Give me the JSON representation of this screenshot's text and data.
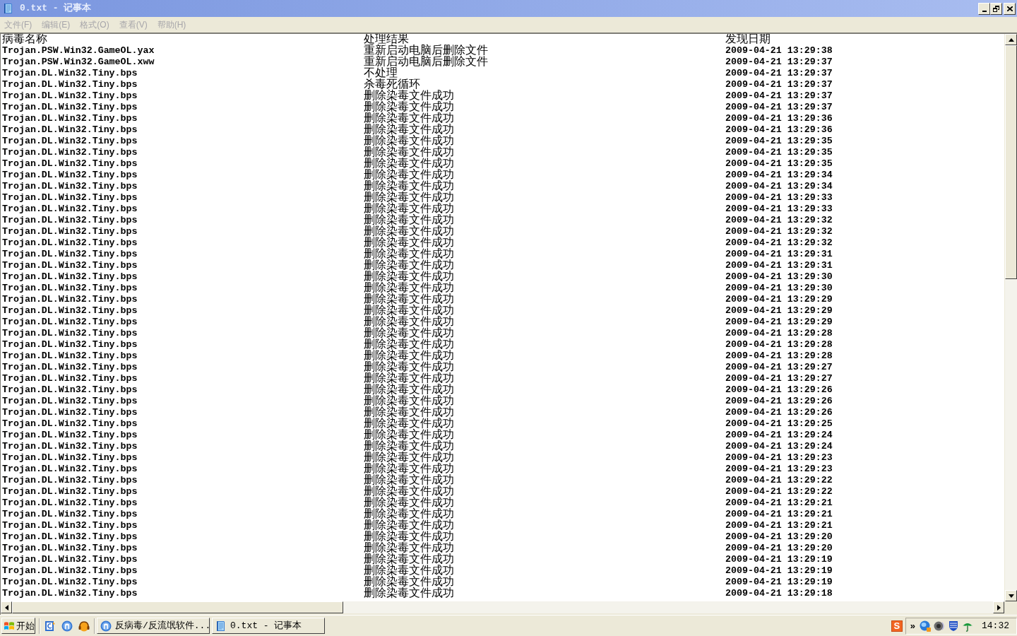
{
  "window": {
    "title": "0.txt - 记事本",
    "active": false
  },
  "menu": [
    "文件(F)",
    "编辑(E)",
    "格式(O)",
    "查看(V)",
    "帮助(H)"
  ],
  "document": {
    "header": [
      "病毒名称",
      "处理结果",
      "发现日期"
    ],
    "rows": [
      {
        "name": "Trojan.PSW.Win32.GameOL.yax",
        "result": "重新启动电脑后删除文件",
        "date": "2009-04-21 13:29:38"
      },
      {
        "name": "Trojan.PSW.Win32.GameOL.xww",
        "result": "重新启动电脑后删除文件",
        "date": "2009-04-21 13:29:37"
      },
      {
        "name": "Trojan.DL.Win32.Tiny.bps",
        "result": "不处理",
        "date": "2009-04-21 13:29:37"
      },
      {
        "name": "Trojan.DL.Win32.Tiny.bps",
        "result": "杀毒死循环",
        "date": "2009-04-21 13:29:37"
      },
      {
        "name": "Trojan.DL.Win32.Tiny.bps",
        "result": "删除染毒文件成功",
        "date": "2009-04-21 13:29:37"
      },
      {
        "name": "Trojan.DL.Win32.Tiny.bps",
        "result": "删除染毒文件成功",
        "date": "2009-04-21 13:29:37"
      },
      {
        "name": "Trojan.DL.Win32.Tiny.bps",
        "result": "删除染毒文件成功",
        "date": "2009-04-21 13:29:36"
      },
      {
        "name": "Trojan.DL.Win32.Tiny.bps",
        "result": "删除染毒文件成功",
        "date": "2009-04-21 13:29:36"
      },
      {
        "name": "Trojan.DL.Win32.Tiny.bps",
        "result": "删除染毒文件成功",
        "date": "2009-04-21 13:29:35"
      },
      {
        "name": "Trojan.DL.Win32.Tiny.bps",
        "result": "删除染毒文件成功",
        "date": "2009-04-21 13:29:35"
      },
      {
        "name": "Trojan.DL.Win32.Tiny.bps",
        "result": "删除染毒文件成功",
        "date": "2009-04-21 13:29:35"
      },
      {
        "name": "Trojan.DL.Win32.Tiny.bps",
        "result": "删除染毒文件成功",
        "date": "2009-04-21 13:29:34"
      },
      {
        "name": "Trojan.DL.Win32.Tiny.bps",
        "result": "删除染毒文件成功",
        "date": "2009-04-21 13:29:34"
      },
      {
        "name": "Trojan.DL.Win32.Tiny.bps",
        "result": "删除染毒文件成功",
        "date": "2009-04-21 13:29:33"
      },
      {
        "name": "Trojan.DL.Win32.Tiny.bps",
        "result": "删除染毒文件成功",
        "date": "2009-04-21 13:29:33"
      },
      {
        "name": "Trojan.DL.Win32.Tiny.bps",
        "result": "删除染毒文件成功",
        "date": "2009-04-21 13:29:32"
      },
      {
        "name": "Trojan.DL.Win32.Tiny.bps",
        "result": "删除染毒文件成功",
        "date": "2009-04-21 13:29:32"
      },
      {
        "name": "Trojan.DL.Win32.Tiny.bps",
        "result": "删除染毒文件成功",
        "date": "2009-04-21 13:29:32"
      },
      {
        "name": "Trojan.DL.Win32.Tiny.bps",
        "result": "删除染毒文件成功",
        "date": "2009-04-21 13:29:31"
      },
      {
        "name": "Trojan.DL.Win32.Tiny.bps",
        "result": "删除染毒文件成功",
        "date": "2009-04-21 13:29:31"
      },
      {
        "name": "Trojan.DL.Win32.Tiny.bps",
        "result": "删除染毒文件成功",
        "date": "2009-04-21 13:29:30"
      },
      {
        "name": "Trojan.DL.Win32.Tiny.bps",
        "result": "删除染毒文件成功",
        "date": "2009-04-21 13:29:30"
      },
      {
        "name": "Trojan.DL.Win32.Tiny.bps",
        "result": "删除染毒文件成功",
        "date": "2009-04-21 13:29:29"
      },
      {
        "name": "Trojan.DL.Win32.Tiny.bps",
        "result": "删除染毒文件成功",
        "date": "2009-04-21 13:29:29"
      },
      {
        "name": "Trojan.DL.Win32.Tiny.bps",
        "result": "删除染毒文件成功",
        "date": "2009-04-21 13:29:29"
      },
      {
        "name": "Trojan.DL.Win32.Tiny.bps",
        "result": "删除染毒文件成功",
        "date": "2009-04-21 13:29:28"
      },
      {
        "name": "Trojan.DL.Win32.Tiny.bps",
        "result": "删除染毒文件成功",
        "date": "2009-04-21 13:29:28"
      },
      {
        "name": "Trojan.DL.Win32.Tiny.bps",
        "result": "删除染毒文件成功",
        "date": "2009-04-21 13:29:28"
      },
      {
        "name": "Trojan.DL.Win32.Tiny.bps",
        "result": "删除染毒文件成功",
        "date": "2009-04-21 13:29:27"
      },
      {
        "name": "Trojan.DL.Win32.Tiny.bps",
        "result": "删除染毒文件成功",
        "date": "2009-04-21 13:29:27"
      },
      {
        "name": "Trojan.DL.Win32.Tiny.bps",
        "result": "删除染毒文件成功",
        "date": "2009-04-21 13:29:26"
      },
      {
        "name": "Trojan.DL.Win32.Tiny.bps",
        "result": "删除染毒文件成功",
        "date": "2009-04-21 13:29:26"
      },
      {
        "name": "Trojan.DL.Win32.Tiny.bps",
        "result": "删除染毒文件成功",
        "date": "2009-04-21 13:29:26"
      },
      {
        "name": "Trojan.DL.Win32.Tiny.bps",
        "result": "删除染毒文件成功",
        "date": "2009-04-21 13:29:25"
      },
      {
        "name": "Trojan.DL.Win32.Tiny.bps",
        "result": "删除染毒文件成功",
        "date": "2009-04-21 13:29:24"
      },
      {
        "name": "Trojan.DL.Win32.Tiny.bps",
        "result": "删除染毒文件成功",
        "date": "2009-04-21 13:29:24"
      },
      {
        "name": "Trojan.DL.Win32.Tiny.bps",
        "result": "删除染毒文件成功",
        "date": "2009-04-21 13:29:23"
      },
      {
        "name": "Trojan.DL.Win32.Tiny.bps",
        "result": "删除染毒文件成功",
        "date": "2009-04-21 13:29:23"
      },
      {
        "name": "Trojan.DL.Win32.Tiny.bps",
        "result": "删除染毒文件成功",
        "date": "2009-04-21 13:29:22"
      },
      {
        "name": "Trojan.DL.Win32.Tiny.bps",
        "result": "删除染毒文件成功",
        "date": "2009-04-21 13:29:22"
      },
      {
        "name": "Trojan.DL.Win32.Tiny.bps",
        "result": "删除染毒文件成功",
        "date": "2009-04-21 13:29:21"
      },
      {
        "name": "Trojan.DL.Win32.Tiny.bps",
        "result": "删除染毒文件成功",
        "date": "2009-04-21 13:29:21"
      },
      {
        "name": "Trojan.DL.Win32.Tiny.bps",
        "result": "删除染毒文件成功",
        "date": "2009-04-21 13:29:21"
      },
      {
        "name": "Trojan.DL.Win32.Tiny.bps",
        "result": "删除染毒文件成功",
        "date": "2009-04-21 13:29:20"
      },
      {
        "name": "Trojan.DL.Win32.Tiny.bps",
        "result": "删除染毒文件成功",
        "date": "2009-04-21 13:29:20"
      },
      {
        "name": "Trojan.DL.Win32.Tiny.bps",
        "result": "删除染毒文件成功",
        "date": "2009-04-21 13:29:19"
      },
      {
        "name": "Trojan.DL.Win32.Tiny.bps",
        "result": "删除染毒文件成功",
        "date": "2009-04-21 13:29:19"
      },
      {
        "name": "Trojan.DL.Win32.Tiny.bps",
        "result": "删除染毒文件成功",
        "date": "2009-04-21 13:29:19"
      },
      {
        "name": "Trojan.DL.Win32.Tiny.bps",
        "result": "删除染毒文件成功",
        "date": "2009-04-21 13:29:18"
      }
    ]
  },
  "taskbar": {
    "start_label": "开始",
    "tasks": [
      {
        "label": "反病毒/反流氓软件...",
        "kind": "antivirus"
      },
      {
        "label": "0.txt - 记事本",
        "kind": "notepad"
      }
    ],
    "ime_label": "S",
    "tray_expand": "»",
    "clock": "14:32"
  }
}
